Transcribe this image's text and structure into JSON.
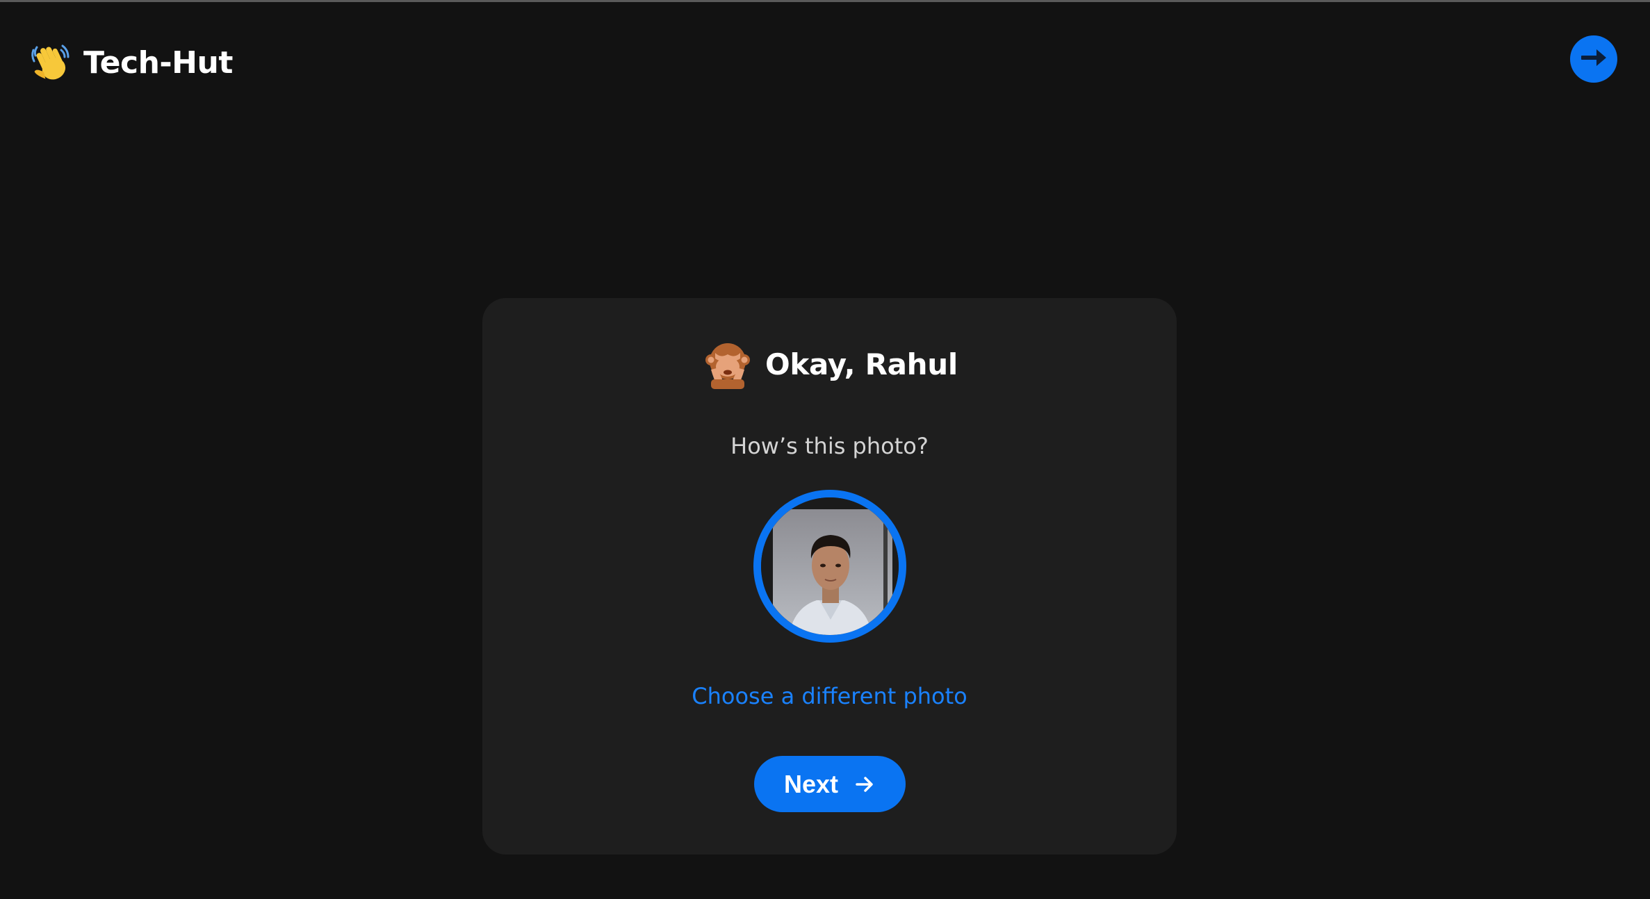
{
  "header": {
    "app_title": "Tech-Hut",
    "logo_icon": "waving-hand-icon",
    "exit_icon": "arrow-right-circle-icon"
  },
  "card": {
    "greeting": "Okay, Rahul",
    "greeting_icon": "see-no-evil-monkey-icon",
    "prompt": "How’s this photo?",
    "change_photo_label": "Choose a different photo",
    "next_label": "Next",
    "next_icon": "arrow-right-icon"
  },
  "colors": {
    "background": "#121212",
    "card": "#1e1e1e",
    "accent": "#0a74f2",
    "link": "#1a82ff"
  }
}
